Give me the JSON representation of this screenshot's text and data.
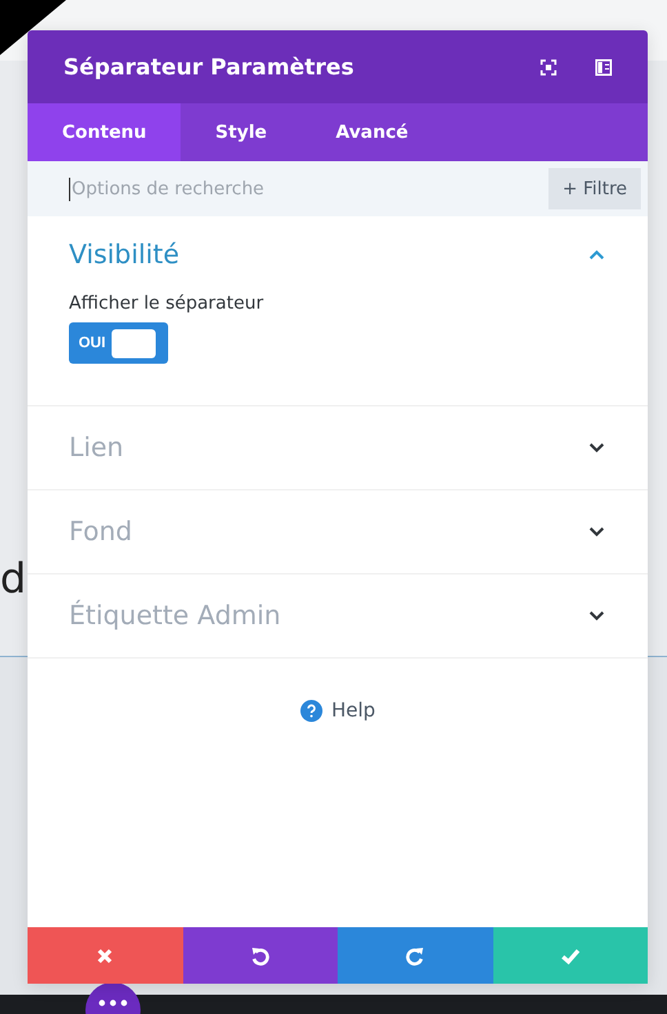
{
  "background": {
    "text": "d"
  },
  "window": {
    "title": "Séparateur Paramètres"
  },
  "tabs": [
    {
      "label": "Contenu",
      "selected": true
    },
    {
      "label": "Style",
      "selected": false
    },
    {
      "label": "Avancé",
      "selected": false
    }
  ],
  "search": {
    "placeholder": "Options de recherche",
    "filter_button": "+ Filtre"
  },
  "sections": [
    {
      "title": "Visibilité",
      "expanded": true,
      "setting": {
        "label": "Afficher le séparateur",
        "toggle_text": "OUI",
        "on": true
      }
    },
    {
      "title": "Lien",
      "expanded": false
    },
    {
      "title": "Fond",
      "expanded": false
    },
    {
      "title": "Étiquette Admin",
      "expanded": false
    }
  ],
  "help": "Help",
  "footer_buttons": [
    {
      "kind": "cancel"
    },
    {
      "kind": "undo"
    },
    {
      "kind": "redo"
    },
    {
      "kind": "save"
    }
  ]
}
